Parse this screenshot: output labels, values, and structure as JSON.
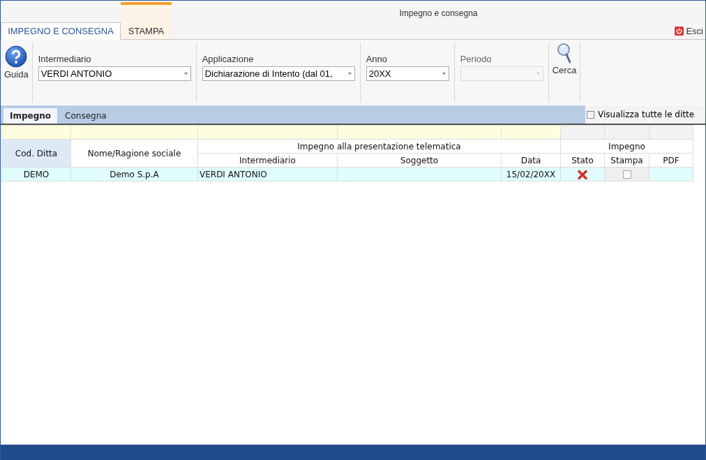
{
  "window": {
    "title": "Impegno e consegna"
  },
  "ribbon_tabs": [
    {
      "label": "IMPEGNO E CONSEGNA",
      "selected": true
    },
    {
      "label": "STAMPA",
      "selected": false
    }
  ],
  "exit_button": {
    "label": "Esci"
  },
  "help_button": {
    "label": "Guida"
  },
  "fields": [
    {
      "label": "Intermediario",
      "value": "VERDI ANTONIO",
      "disabled": false
    },
    {
      "label": "Applicazione",
      "value": "Dichiarazione di Intento (dal 01,",
      "disabled": false
    },
    {
      "label": "Anno",
      "value": "20XX",
      "disabled": false
    },
    {
      "label": "Periodo",
      "disabled": true
    }
  ],
  "search_button": {
    "label": "Cerca"
  },
  "view_tabs": [
    {
      "label": "Impegno",
      "selected": true
    },
    {
      "label": "Consegna",
      "selected": false
    }
  ],
  "show_all_checkbox": {
    "label": "Visualizza tutte le ditte",
    "checked": false
  },
  "table": {
    "columns": [
      {
        "label": "Cod. Ditta"
      },
      {
        "label": "Nome/Ragione sociale"
      }
    ],
    "groups": [
      {
        "label": "Impegno alla presentazione telematica",
        "columns": [
          "Intermediario",
          "Soggetto",
          "Data"
        ]
      },
      {
        "label": "Impegno",
        "columns": [
          "Stato",
          "Stampa",
          "PDF"
        ]
      }
    ],
    "rows": [
      {
        "cod_ditta": "DEMO",
        "nome": "Demo S.p.A",
        "intermediario": "VERDI ANTONIO",
        "data": "15/02/20XX",
        "stato_icon": {
          "kind": "error"
        },
        "stampa_checked": false
      }
    ]
  }
}
